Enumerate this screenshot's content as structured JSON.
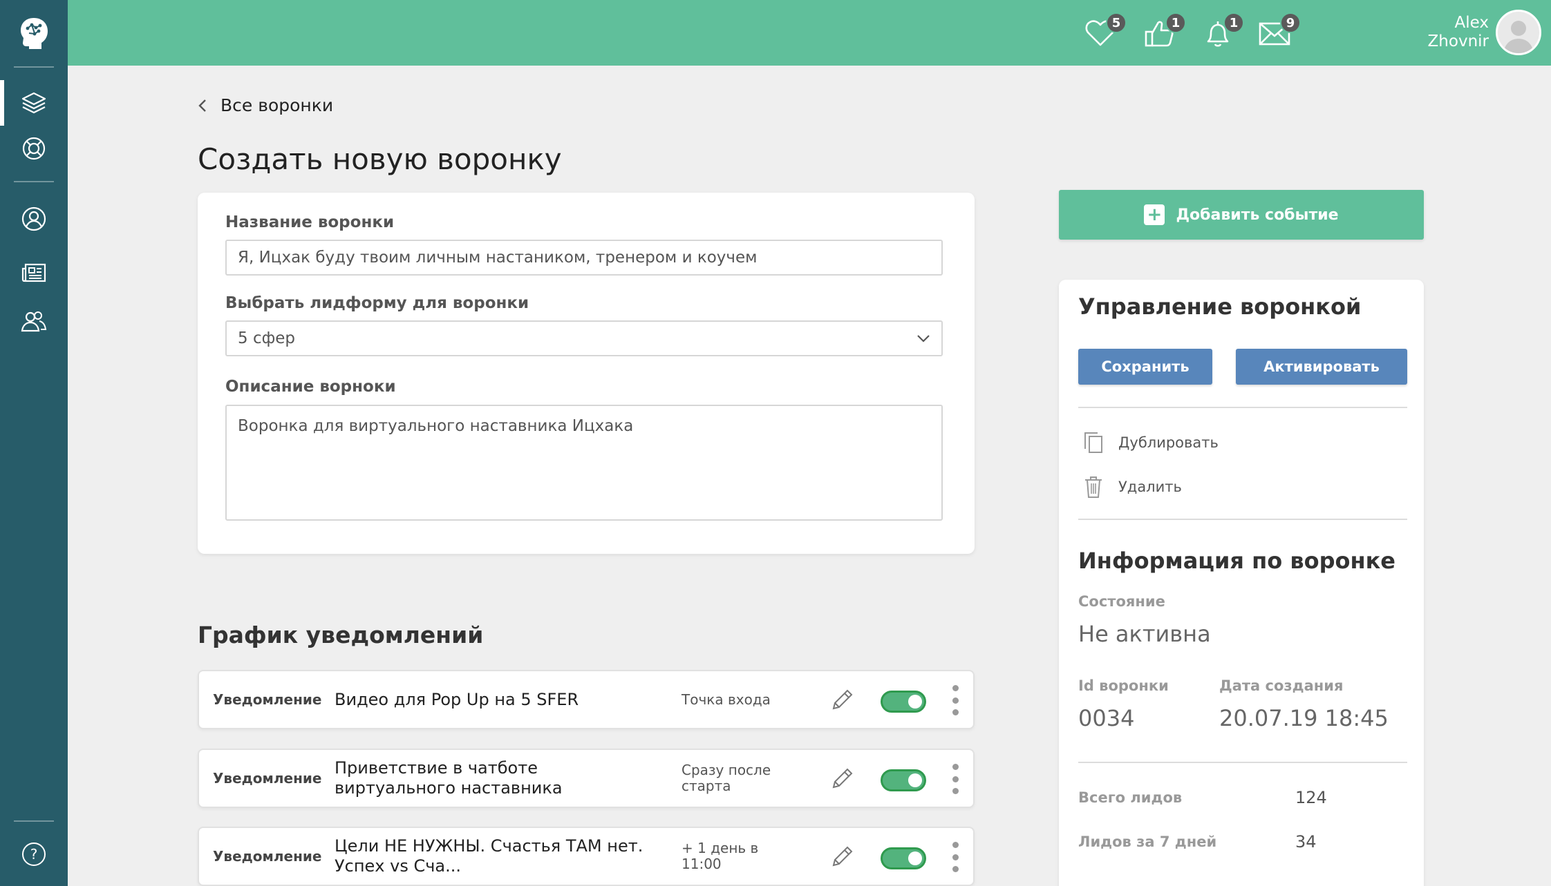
{
  "header": {
    "user_first": "Alex",
    "user_last": "Zhovnir",
    "badges": {
      "likes": "5",
      "thumbs": "1",
      "bell": "1",
      "mail": "9"
    }
  },
  "breadcrumb": {
    "back_label": "Все воронки"
  },
  "page_title": "Создать новую воронку",
  "form": {
    "name_label": "Название воронки",
    "name_value": "Я, Ицхак буду твоим личным настаником, тренером и коучем",
    "leadform_label": "Выбрать лидформу для воронки",
    "leadform_value": "5 сфер",
    "description_label": "Описание ворноки",
    "description_value": "Воронка для виртуального наставника Ицхака"
  },
  "schedule": {
    "title": "График уведомлений",
    "rows": [
      {
        "type": "Уведомление",
        "title": "Видео для Pop Up на 5 SFER",
        "when": "Точка входа"
      },
      {
        "type": "Уведомление",
        "title": "Приветствие в чатботе виртуального наставника",
        "when": "Сразу после старта"
      },
      {
        "type": "Уведомление",
        "title": "Цели НЕ НУЖНЫ. Счастья ТАМ нет. Успех vs Сча...",
        "when": "+ 1 день в 11:00"
      }
    ]
  },
  "right": {
    "add_event_label": "Добавить событие",
    "manage_title": "Управление воронкой",
    "save_label": "Сохранить",
    "activate_label": "Активировать",
    "duplicate_label": "Дублировать",
    "delete_label": "Удалить",
    "info_title": "Информация по воронке",
    "state_label": "Состояние",
    "state_value": "Не активна",
    "id_label": "Id воронки",
    "id_value": "0034",
    "created_label": "Дата создания",
    "created_value": "20.07.19 18:45",
    "total_leads_label": "Всего лидов",
    "total_leads_value": "124",
    "leads_7d_label": "Лидов за 7 дней",
    "leads_7d_value": "34"
  },
  "colors": {
    "sidebar": "#275c69",
    "topbar": "#60bf9b",
    "primary_button": "#5886bb",
    "toggle_on": "#53b37d"
  },
  "icons": {
    "sidebar": [
      "brain-logo-icon",
      "layers-icon",
      "lifebuoy-icon",
      "user-icon",
      "news-icon",
      "team-icon",
      "help-icon"
    ],
    "header": [
      "heart-icon",
      "thumbs-up-icon",
      "bell-icon",
      "mail-icon"
    ]
  }
}
